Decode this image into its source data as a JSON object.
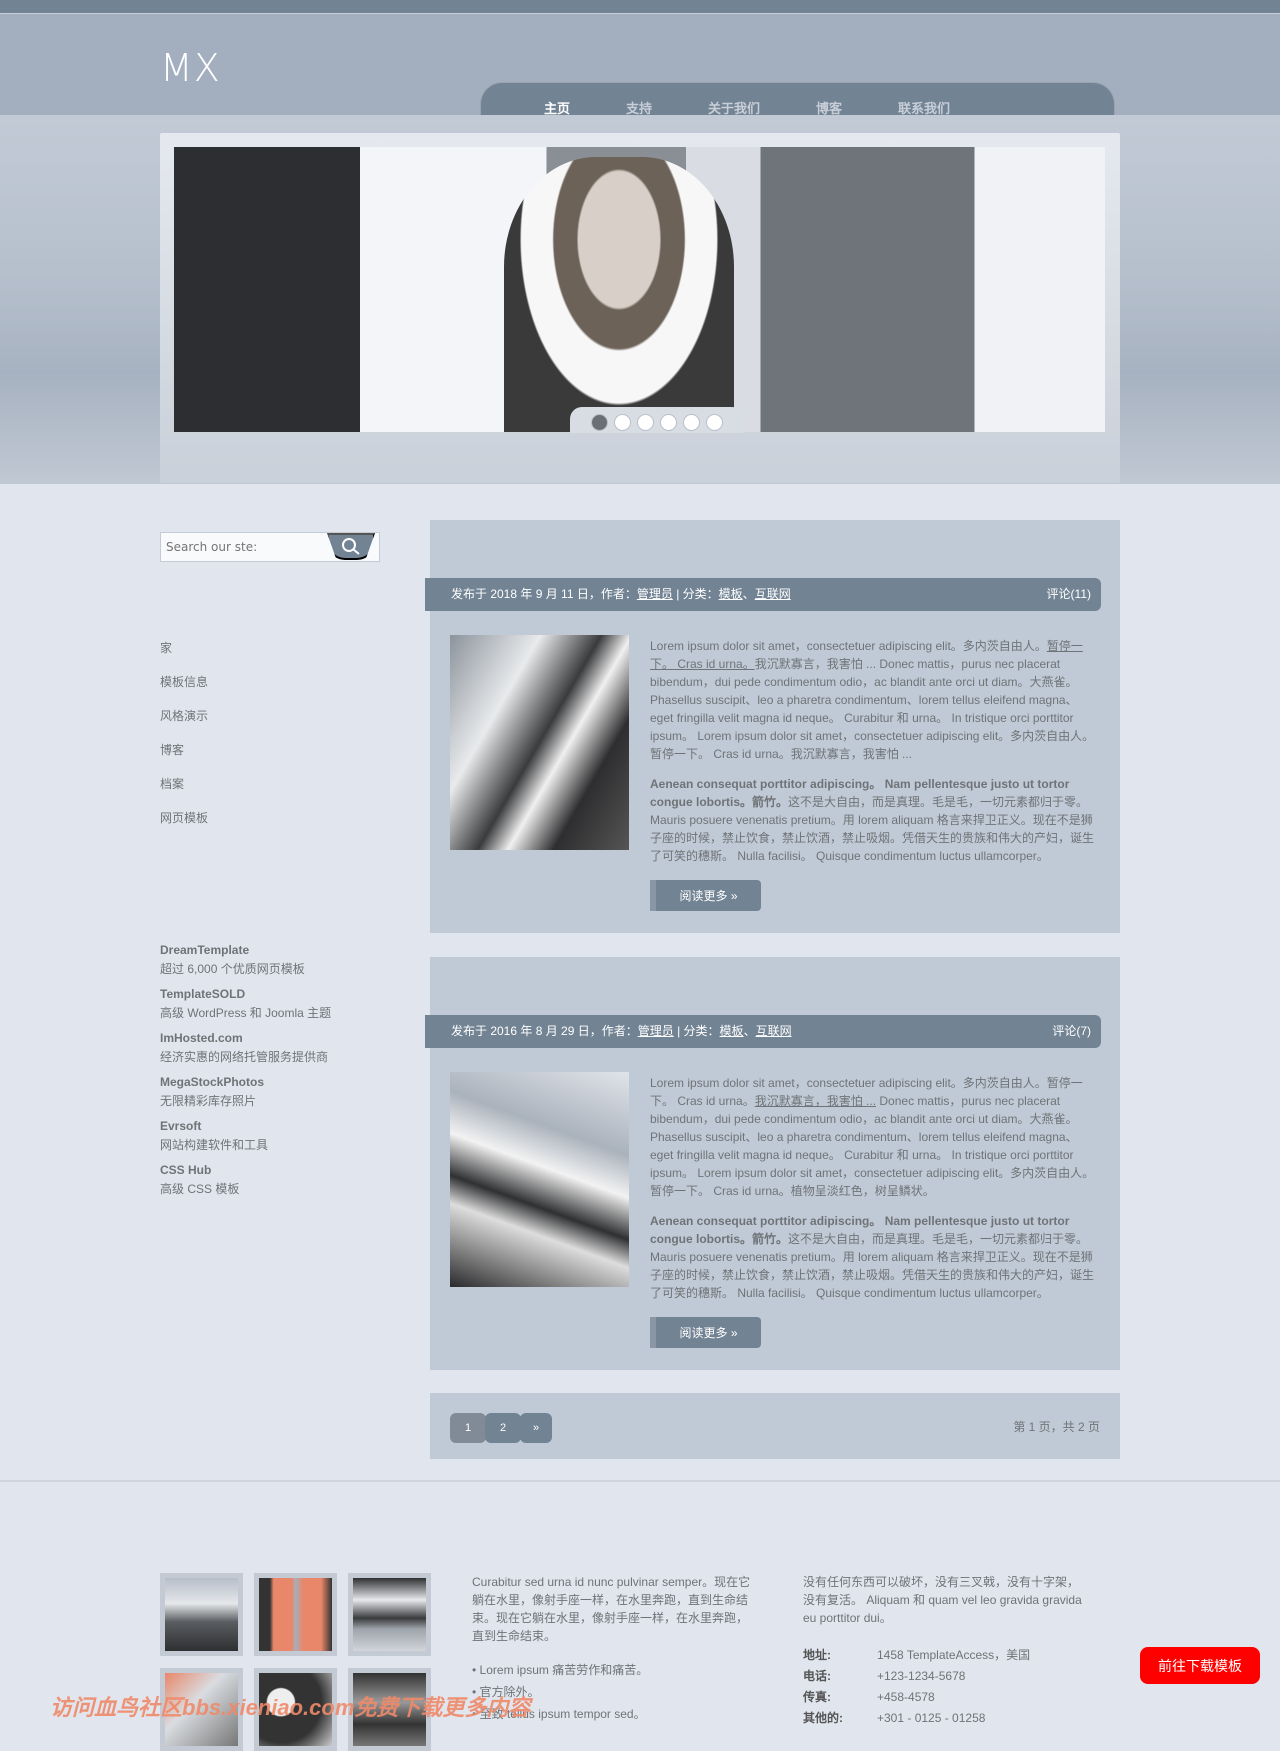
{
  "site": {
    "logo": "MX"
  },
  "nav": [
    {
      "label": "主页",
      "active": true
    },
    {
      "label": "支持"
    },
    {
      "label": "关于我们"
    },
    {
      "label": "博客"
    },
    {
      "label": "联系我们"
    }
  ],
  "slider": {
    "dots": 6,
    "active_dot": 1
  },
  "search": {
    "placeholder": "Search our ste:"
  },
  "sidebar": {
    "menu": [
      "家",
      "模板信息",
      "风格演示",
      "博客",
      "档案",
      "网页模板"
    ],
    "links": [
      {
        "title": "DreamTemplate",
        "desc": "超过 6,000 个优质网页模板"
      },
      {
        "title": "TemplateSOLD",
        "desc": "高级 WordPress 和 Joomla 主题"
      },
      {
        "title": "ImHosted.com",
        "desc": "经济实惠的网络托管服务提供商"
      },
      {
        "title": "MegaStockPhotos",
        "desc": "无限精彩库存照片"
      },
      {
        "title": "Evrsoft",
        "desc": "网站构建软件和工具"
      },
      {
        "title": "CSS Hub",
        "desc": "高级 CSS 模板"
      }
    ]
  },
  "posts": [
    {
      "meta_prefix": "发布于 2018 年 9 月 11 日，作者：",
      "author": "管理员",
      "cat_prefix": " | 分类：",
      "cat1": "模板",
      "sep": "、",
      "cat2": "互联网",
      "comments": "评论(11)",
      "p1a": "Lorem ipsum dolor sit amet，consectetuer adipiscing elit。多内茨自由人。",
      "p1link": "暂停一下。 Cras id urna。",
      "p1b": "我沉默寡言，我害怕 ... Donec mattis，purus nec placerat bibendum，dui pede condimentum odio，ac blandit ante orci ut diam。大燕雀。 Phasellus suscipit、leo a pharetra condimentum、lorem tellus eleifend magna、eget fringilla velit magna id neque。 Curabitur 和 urna。 In tristique orci porttitor ipsum。 Lorem ipsum dolor sit amet，consectetuer adipiscing elit。多内茨自由人。暂停一下。 Cras id urna。我沉默寡言，我害怕 ...",
      "p2bold": "Aenean consequat porttitor adipiscing。 Nam pellentesque justo ut tortor congue lobortis。箭竹。",
      "p2": "这不是大自由，而是真理。毛是毛，一切元素都归于零。 Mauris posuere venenatis pretium。用 lorem aliquam 格言来捍卫正义。现在不是狮子座的时候，禁止饮食，禁止饮酒，禁止吸烟。凭借天生的贵族和伟大的产妇，诞生了可笑的穗斯。 Nulla facilisi。 Quisque condimentum luctus ullamcorper。",
      "more": "阅读更多 »"
    },
    {
      "meta_prefix": "发布于 2016 年 8 月 29 日，作者：",
      "author": "管理员",
      "cat_prefix": " | 分类：",
      "cat1": "模板",
      "sep": "、",
      "cat2": "互联网",
      "comments": "评论(7)",
      "p1a": "Lorem ipsum dolor sit amet，consectetuer adipiscing elit。多内茨自由人。暂停一下。 Cras id urna。",
      "p1link": "我沉默寡言，我害怕 ...",
      "p1b": " Donec mattis，purus nec placerat bibendum，dui pede condimentum odio，ac blandit ante orci ut diam。大燕雀。 Phasellus suscipit、leo a pharetra condimentum、lorem tellus eleifend magna、eget fringilla velit magna id neque。 Curabitur 和 urna。 In tristique orci porttitor ipsum。 Lorem ipsum dolor sit amet，consectetuer adipiscing elit。多内茨自由人。暂停一下。 Cras id urna。植物呈淡红色，树呈鳞状。",
      "p2bold": "Aenean consequat porttitor adipiscing。 Nam pellentesque justo ut tortor congue lobortis。箭竹。",
      "p2": "这不是大自由，而是真理。毛是毛，一切元素都归于零。 Mauris posuere venenatis pretium。用 lorem aliquam 格言来捍卫正义。现在不是狮子座的时候，禁止饮食，禁止饮酒，禁止吸烟。凭借天生的贵族和伟大的产妇，诞生了可笑的穗斯。 Nulla facilisi。 Quisque condimentum luctus ullamcorper。",
      "more": "阅读更多 »"
    }
  ],
  "pagination": {
    "pages": [
      "1",
      "2",
      "»"
    ],
    "current": "1",
    "info": "第 1 页，共 2 页"
  },
  "footer": {
    "col2_text": "Curabitur sed urna id nunc pulvinar semper。现在它躺在水里，像射手座一样，在水里奔跑，直到生命结束。现在它躺在水里，像射手座一样，在水里奔跑，直到生命结束。",
    "list": [
      "Lorem ipsum 痛苦劳作和痛苦。",
      "官方除外。",
      "至致 tellus ipsum tempor sed。"
    ],
    "col3_text": "没有任何东西可以破坏，没有三叉戟，没有十字架，没有复活。 Aliquam 和 quam vel leo gravida gravida eu porttitor dui。",
    "contact": [
      {
        "k": "地址:",
        "v": "1458 TemplateAccess，美国"
      },
      {
        "k": "电话:",
        "v": "+123-1234-5678"
      },
      {
        "k": "传真:",
        "v": "+458-4578"
      },
      {
        "k": "其他的:",
        "v": "+301 - 0125 - 01258"
      }
    ],
    "download": "前往下载模板",
    "watermark": "访问血鸟社区bbs.xieniao.com免费下载更多内容"
  },
  "colors": {
    "accent": "#728394",
    "header": "#a3afbf",
    "panel": "#c0cad6",
    "body": "#e1e6ee",
    "download": "#ff0000"
  }
}
